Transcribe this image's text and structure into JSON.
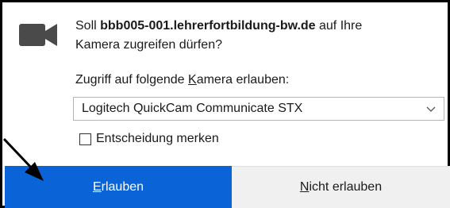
{
  "icons": {
    "camera": "camera-icon",
    "select_chevron": "chevron-down-icon",
    "pointer": "arrow-icon"
  },
  "colors": {
    "allow_button_bg": "#0a64d8",
    "deny_button_bg": "#f0f0f0",
    "icon_gray": "#4a4a4a"
  },
  "prompt": {
    "prefix": "Soll ",
    "host": "bbb005-001.lehrerfortbildung-bw.de",
    "suffix_line1": " auf Ihre",
    "line2": "Kamera zugreifen dürfen?"
  },
  "select": {
    "label_before": "Zugriff auf folgende ",
    "label_access_key": "K",
    "label_after": "amera erlauben:",
    "value": "Logitech QuickCam Communicate STX"
  },
  "remember": {
    "label": "Entscheidung merken",
    "checked": false
  },
  "buttons": {
    "allow_access_key": "E",
    "allow_rest": "rlauben",
    "deny_access_key": "N",
    "deny_rest": "icht erlauben"
  }
}
